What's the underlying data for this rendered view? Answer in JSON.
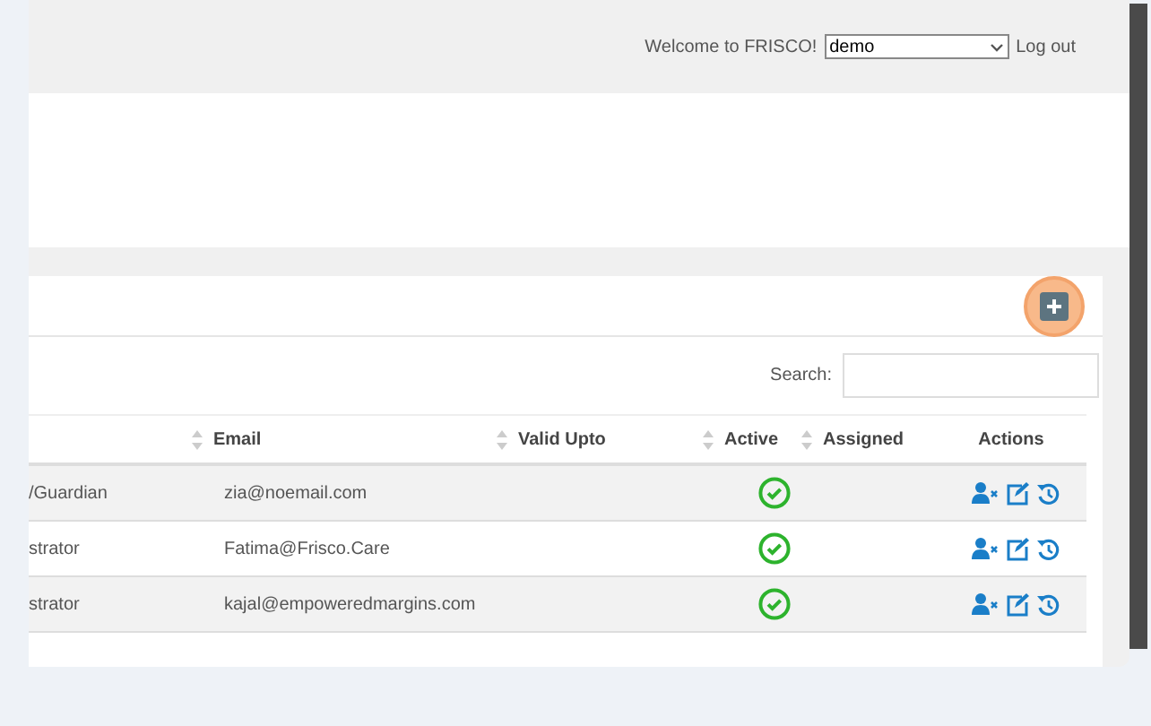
{
  "header": {
    "welcome": "Welcome to FRISCO!",
    "user_select": {
      "value": "demo"
    },
    "logout": "Log out"
  },
  "search": {
    "label": "Search:"
  },
  "table": {
    "columns": [
      {
        "sortable": true
      },
      {
        "label": "Email",
        "sortable": true
      },
      {
        "label": "Valid Upto",
        "sortable": true
      },
      {
        "label": "Active",
        "sortable": true
      },
      {
        "label": "Assigned",
        "sortable": false
      },
      {
        "label": "Actions",
        "sortable": false
      }
    ],
    "rows": [
      {
        "column_1": "/Guardian",
        "email": "zia@noemail.com",
        "active": true
      },
      {
        "column_1": "strator",
        "email": "Fatima@Frisco.Care",
        "active": true
      },
      {
        "column_1": "strator",
        "email": "kajal@empoweredmargins.com",
        "active": true
      }
    ]
  }
}
